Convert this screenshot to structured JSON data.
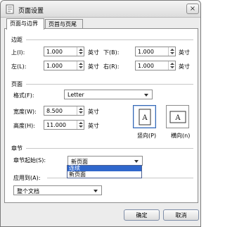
{
  "window": {
    "title": "页面设置",
    "close_label": "×"
  },
  "tabs": [
    {
      "label": "页面与边界"
    },
    {
      "label": "页首与页尾"
    }
  ],
  "margins": {
    "heading": "边距",
    "top_label": "上(I):",
    "top_value": "1.000",
    "top_unit": "英寸",
    "bottom_label": "下(B):",
    "bottom_value": "1.000",
    "bottom_unit": "英寸",
    "left_label": "左(L):",
    "left_value": "1.000",
    "left_unit": "英寸",
    "right_label": "右(R):",
    "right_value": "1.000",
    "right_unit": "英寸"
  },
  "page": {
    "heading": "页面",
    "format_label": "格式(F):",
    "format_value": "Letter",
    "width_label": "宽度(W):",
    "width_value": "8.500",
    "width_unit": "英寸",
    "height_label": "高度(H):",
    "height_value": "11.000",
    "height_unit": "英寸",
    "portrait_label": "竖向(P)",
    "landscape_label": "横向(n)",
    "icon_letter": "A"
  },
  "section": {
    "heading": "章节",
    "start_label": "章节起始(S):",
    "start_value": "新页面",
    "options": [
      "连续",
      "新页面"
    ]
  },
  "apply": {
    "label": "应用到(A):",
    "value": "整个文档"
  },
  "buttons": {
    "ok": "确定",
    "cancel": "取消"
  },
  "colors": {
    "selection": "#2f67cc",
    "selected_border": "#3569b4"
  }
}
